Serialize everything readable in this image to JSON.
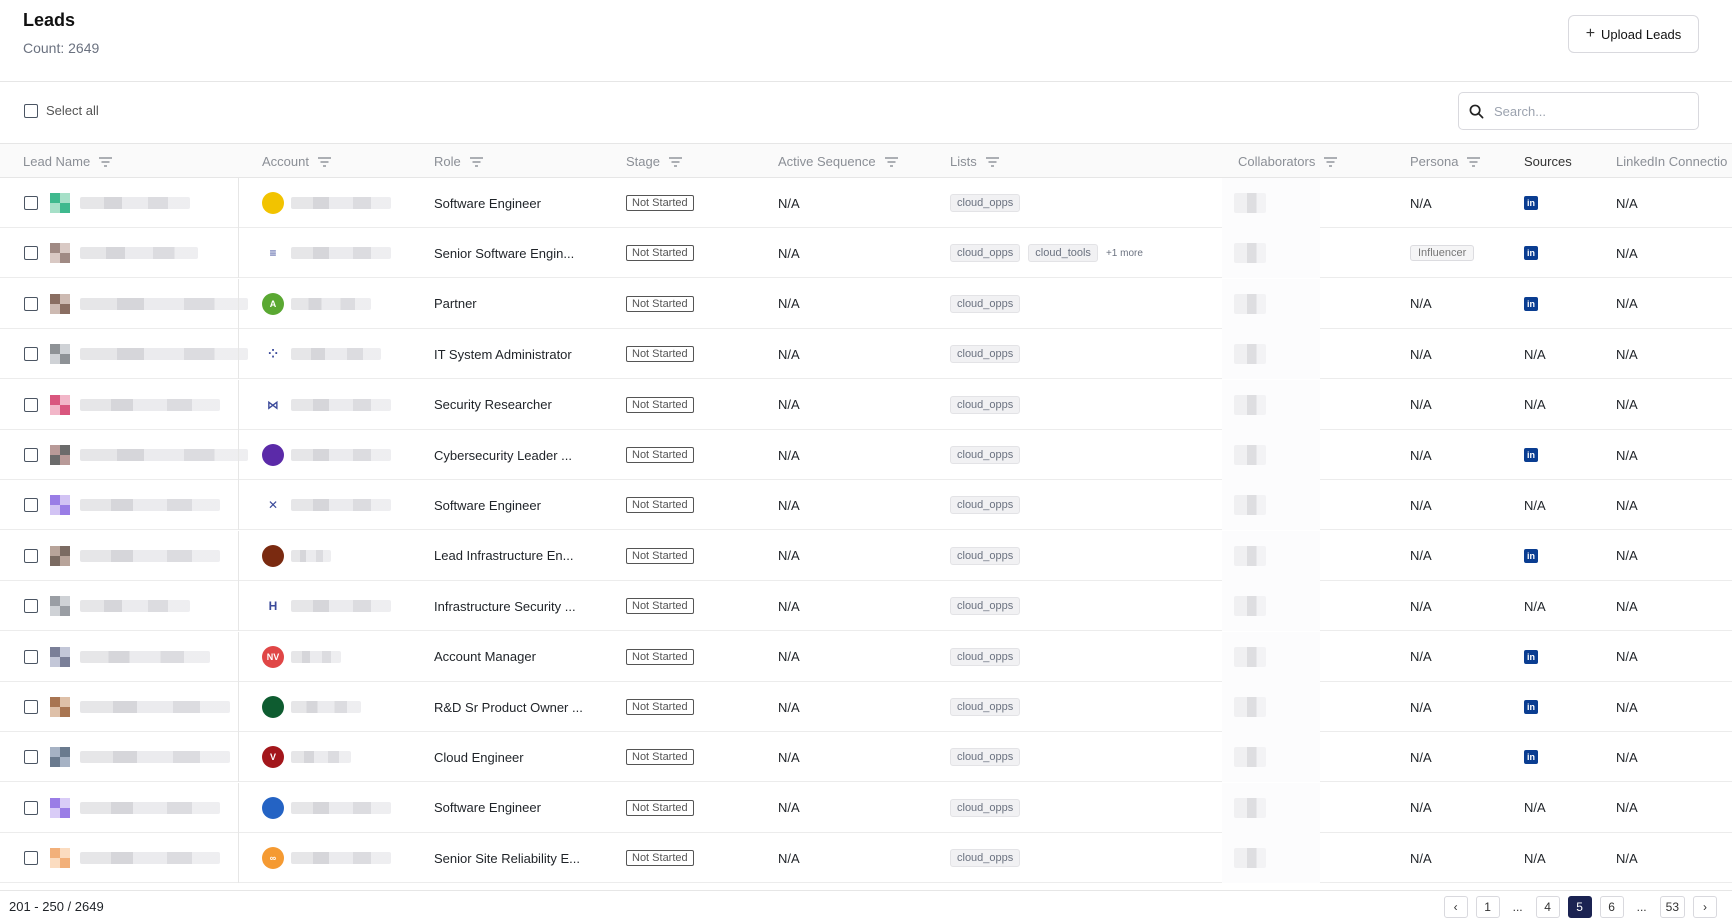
{
  "header": {
    "title": "Leads",
    "count": "Count: 2649",
    "upload_label": "Upload Leads"
  },
  "toolbar": {
    "select_all": "Select all",
    "search_placeholder": "Search..."
  },
  "columns": [
    "Lead Name",
    "Account",
    "Role",
    "Stage",
    "Active Sequence",
    "Lists",
    "Collaborators",
    "Persona",
    "Sources",
    "LinkedIn Connectio"
  ],
  "rows": [
    {
      "role": "Software Engineer",
      "stage": "Not Started",
      "sequence": "N/A",
      "lists": [
        "cloud_opps"
      ],
      "more": "",
      "persona": "N/A",
      "source": "linkedin",
      "linkedin": "N/A"
    },
    {
      "role": "Senior Software Engin...",
      "stage": "Not Started",
      "sequence": "N/A",
      "lists": [
        "cloud_opps",
        "cloud_tools"
      ],
      "more": "+1 more",
      "persona": "Influencer",
      "source": "linkedin",
      "linkedin": "N/A"
    },
    {
      "role": "Partner",
      "stage": "Not Started",
      "sequence": "N/A",
      "lists": [
        "cloud_opps"
      ],
      "more": "",
      "persona": "N/A",
      "source": "linkedin",
      "linkedin": "N/A"
    },
    {
      "role": "IT System Administrator",
      "stage": "Not Started",
      "sequence": "N/A",
      "lists": [
        "cloud_opps"
      ],
      "more": "",
      "persona": "N/A",
      "source": "N/A",
      "linkedin": "N/A"
    },
    {
      "role": "Security Researcher",
      "stage": "Not Started",
      "sequence": "N/A",
      "lists": [
        "cloud_opps"
      ],
      "more": "",
      "persona": "N/A",
      "source": "N/A",
      "linkedin": "N/A"
    },
    {
      "role": "Cybersecurity Leader ...",
      "stage": "Not Started",
      "sequence": "N/A",
      "lists": [
        "cloud_opps"
      ],
      "more": "",
      "persona": "N/A",
      "source": "linkedin",
      "linkedin": "N/A"
    },
    {
      "role": "Software Engineer",
      "stage": "Not Started",
      "sequence": "N/A",
      "lists": [
        "cloud_opps"
      ],
      "more": "",
      "persona": "N/A",
      "source": "N/A",
      "linkedin": "N/A"
    },
    {
      "role": "Lead Infrastructure En...",
      "stage": "Not Started",
      "sequence": "N/A",
      "lists": [
        "cloud_opps"
      ],
      "more": "",
      "persona": "N/A",
      "source": "linkedin",
      "linkedin": "N/A"
    },
    {
      "role": "Infrastructure Security ...",
      "stage": "Not Started",
      "sequence": "N/A",
      "lists": [
        "cloud_opps"
      ],
      "more": "",
      "persona": "N/A",
      "source": "N/A",
      "linkedin": "N/A"
    },
    {
      "role": "Account Manager",
      "stage": "Not Started",
      "sequence": "N/A",
      "lists": [
        "cloud_opps"
      ],
      "more": "",
      "persona": "N/A",
      "source": "linkedin",
      "linkedin": "N/A"
    },
    {
      "role": "R&D Sr Product Owner ...",
      "stage": "Not Started",
      "sequence": "N/A",
      "lists": [
        "cloud_opps"
      ],
      "more": "",
      "persona": "N/A",
      "source": "linkedin",
      "linkedin": "N/A"
    },
    {
      "role": "Cloud Engineer",
      "stage": "Not Started",
      "sequence": "N/A",
      "lists": [
        "cloud_opps"
      ],
      "more": "",
      "persona": "N/A",
      "source": "linkedin",
      "linkedin": "N/A"
    },
    {
      "role": "Software Engineer",
      "stage": "Not Started",
      "sequence": "N/A",
      "lists": [
        "cloud_opps"
      ],
      "more": "",
      "persona": "N/A",
      "source": "N/A",
      "linkedin": "N/A"
    },
    {
      "role": "Senior Site Reliability E...",
      "stage": "Not Started",
      "sequence": "N/A",
      "lists": [
        "cloud_opps"
      ],
      "more": "",
      "persona": "N/A",
      "source": "N/A",
      "linkedin": "N/A"
    }
  ],
  "account_logos": [
    {
      "color": "#f2c300",
      "text": "",
      "icon": "lion-logo-icon"
    },
    {
      "color": "#ffffff",
      "text": "≡",
      "icon": "stack-logo-icon"
    },
    {
      "color": "#5aa832",
      "text": "A",
      "icon": "a-logo-icon"
    },
    {
      "color": "#ffffff",
      "text": "⁘",
      "icon": "dots-logo-icon"
    },
    {
      "color": "#ffffff",
      "text": "⋈",
      "icon": "wave-logo-icon"
    },
    {
      "color": "#5b2aa8",
      "text": "",
      "icon": "purple-logo-icon"
    },
    {
      "color": "#ffffff",
      "text": "✕",
      "icon": "x-logo-icon"
    },
    {
      "color": "#7a2a10",
      "text": "",
      "icon": "circle-logo-icon"
    },
    {
      "color": "#ffffff",
      "text": "H",
      "icon": "hyundai-logo-icon"
    },
    {
      "color": "#e04646",
      "text": "NV",
      "icon": "nv-logo-icon"
    },
    {
      "color": "#0e5c30",
      "text": "",
      "icon": "green-logo-icon"
    },
    {
      "color": "#a3161b",
      "text": "V",
      "icon": "v-logo-icon"
    },
    {
      "color": "#2463c4",
      "text": "",
      "icon": "globe-logo-icon"
    },
    {
      "color": "#f59a32",
      "text": "∞",
      "icon": "infinity-logo-icon"
    }
  ],
  "avatar_colors": [
    [
      "#3fb98e",
      "#a6e0c8"
    ],
    [
      "#a08a84",
      "#d9c9c4"
    ],
    [
      "#8a6e62",
      "#cdbab2"
    ],
    [
      "#8e9296",
      "#cfd2d6"
    ],
    [
      "#d9567e",
      "#f2b6c8"
    ],
    [
      "#b89a98",
      "#6b6b6b"
    ],
    [
      "#9a7de6",
      "#d2c3f4"
    ],
    [
      "#b8a49a",
      "#7b6b62"
    ],
    [
      "#9a9ea4",
      "#cfd2d6"
    ],
    [
      "#7a7f98",
      "#c3c7d8"
    ],
    [
      "#a87552",
      "#dec0a8"
    ],
    [
      "#a6b2c4",
      "#6a7a8e"
    ],
    [
      "#9a7de6",
      "#d9ccf7"
    ],
    [
      "#f2b07a",
      "#fbdcc0"
    ]
  ],
  "name_widths": [
    110,
    118,
    168,
    168,
    140,
    168,
    140,
    140,
    110,
    130,
    150,
    150,
    140,
    140
  ],
  "account_widths": [
    100,
    100,
    80,
    90,
    100,
    100,
    100,
    40,
    100,
    50,
    70,
    60,
    100,
    100
  ],
  "footer": {
    "range": "201 - 250 / 2649",
    "pages": [
      "1",
      "...",
      "4",
      "5",
      "6",
      "...",
      "53"
    ],
    "active_page": "5",
    "prev": "‹",
    "next": "›"
  }
}
